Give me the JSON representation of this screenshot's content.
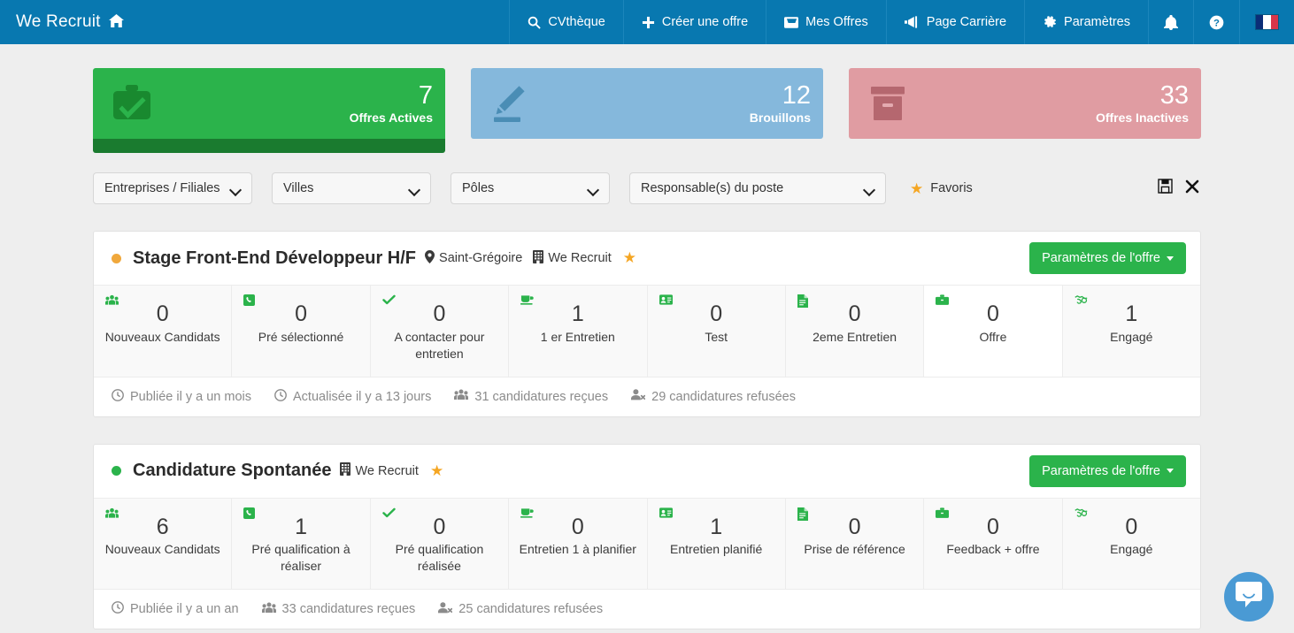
{
  "navbar": {
    "brand": "We Recruit",
    "brand_icon": "home-icon",
    "items": [
      {
        "label": "CVthèque",
        "icon": "search-icon"
      },
      {
        "label": "Créer une offre",
        "icon": "plus-icon"
      },
      {
        "label": "Mes Offres",
        "icon": "inbox-icon"
      },
      {
        "label": "Page Carrière",
        "icon": "megaphone-icon"
      },
      {
        "label": "Paramètres",
        "icon": "gear-icon"
      }
    ],
    "notifications_icon": "bell-icon",
    "help_icon": "question-circle-icon",
    "language_icon": "french-flag-icon",
    "bg_color": "#0878b0"
  },
  "stats": [
    {
      "number": "7",
      "label": "Offres Actives",
      "icon": "briefcase-check-icon",
      "color": "#2bb34b",
      "footer_color": "#1a7b2f",
      "has_footer": true
    },
    {
      "number": "12",
      "label": "Brouillons",
      "icon": "pencil-icon",
      "color": "#85b8dc",
      "footer_color": "",
      "has_footer": false
    },
    {
      "number": "33",
      "label": "Offres Inactives",
      "icon": "archive-box-icon",
      "color": "#e09ca2",
      "footer_color": "",
      "has_footer": false
    }
  ],
  "filters": {
    "selects": [
      {
        "label": "Entreprises / Filiales"
      },
      {
        "label": "Villes"
      },
      {
        "label": "Pôles"
      },
      {
        "label": "Responsable(s) du poste"
      }
    ],
    "favoris_label": "Favoris",
    "favoris_icon": "star-icon",
    "save_icon": "floppy-save-icon",
    "clear_icon": "close-x-icon"
  },
  "offers": [
    {
      "status_color": "#f0a83c",
      "title": "Stage Front-End Développeur H/F",
      "location": "Saint-Grégoire",
      "location_icon": "map-pin-icon",
      "company": "We Recruit",
      "company_icon": "building-icon",
      "favorite_icon": "star-icon",
      "settings_label": "Paramètres de l'offre",
      "stages": [
        {
          "count": "0",
          "label": "Nouveaux Candidats",
          "icon": "users-icon",
          "highlight": false
        },
        {
          "count": "0",
          "label": "Pré sélectionné",
          "icon": "phone-square-icon",
          "highlight": false
        },
        {
          "count": "0",
          "label": "A contacter pour entretien",
          "icon": "check-icon",
          "highlight": false
        },
        {
          "count": "1",
          "label": "1 er Entretien",
          "icon": "coffee-icon",
          "highlight": false
        },
        {
          "count": "0",
          "label": "Test",
          "icon": "id-card-icon",
          "highlight": false
        },
        {
          "count": "0",
          "label": "2eme Entretien",
          "icon": "file-text-icon",
          "highlight": false
        },
        {
          "count": "0",
          "label": "Offre",
          "icon": "briefcase-icon",
          "highlight": true
        },
        {
          "count": "1",
          "label": "Engagé",
          "icon": "handshake-icon",
          "highlight": false
        }
      ],
      "footer": [
        {
          "text": "Publiée il y a un mois",
          "icon": "clock-icon"
        },
        {
          "text": "Actualisée il y a 13 jours",
          "icon": "clock-icon"
        },
        {
          "text": "31 candidatures reçues",
          "icon": "users-icon"
        },
        {
          "text": "29 candidatures refusées",
          "icon": "user-times-icon"
        }
      ]
    },
    {
      "status_color": "#2bb34b",
      "title": "Candidature Spontanée",
      "location": "",
      "location_icon": "",
      "company": "We Recruit",
      "company_icon": "building-icon",
      "favorite_icon": "star-icon",
      "settings_label": "Paramètres de l'offre",
      "stages": [
        {
          "count": "6",
          "label": "Nouveaux Candidats",
          "icon": "users-icon",
          "highlight": false
        },
        {
          "count": "1",
          "label": "Pré qualification à réaliser",
          "icon": "phone-square-icon",
          "highlight": false
        },
        {
          "count": "0",
          "label": "Pré qualification réalisée",
          "icon": "check-icon",
          "highlight": false
        },
        {
          "count": "0",
          "label": "Entretien 1 à planifier",
          "icon": "coffee-icon",
          "highlight": false
        },
        {
          "count": "1",
          "label": "Entretien planifié",
          "icon": "id-card-icon",
          "highlight": false
        },
        {
          "count": "0",
          "label": "Prise de référence",
          "icon": "file-text-icon",
          "highlight": false
        },
        {
          "count": "0",
          "label": "Feedback + offre",
          "icon": "briefcase-icon",
          "highlight": false
        },
        {
          "count": "0",
          "label": "Engagé",
          "icon": "handshake-icon",
          "highlight": false
        }
      ],
      "footer": [
        {
          "text": "Publiée il y a un an",
          "icon": "clock-icon"
        },
        {
          "text": "33 candidatures reçues",
          "icon": "users-icon"
        },
        {
          "text": "25 candidatures refusées",
          "icon": "user-times-icon"
        }
      ]
    }
  ],
  "chat_widget": {
    "icon": "chat-bubble-icon",
    "color": "#4a9ad4"
  }
}
